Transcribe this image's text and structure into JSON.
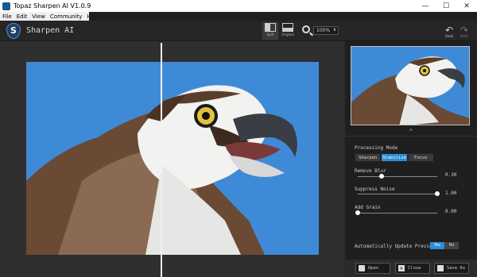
{
  "window": {
    "title": "Topaz Sharpen AI V1.0.9",
    "minimize": "—",
    "maximize": "☐",
    "close": "✕"
  },
  "menu": [
    "File",
    "Edit",
    "View",
    "Community",
    "Help"
  ],
  "app": {
    "name": "Sharpen AI",
    "logo_letter": "S"
  },
  "toolbar": {
    "split_label": "Split",
    "original_label": "Original",
    "zoom_value": "100%",
    "undo_label": "Undo",
    "redo_label": "Redo",
    "undo_icon": "↶",
    "redo_icon": "↷"
  },
  "panel": {
    "collapse_icon": "^",
    "processing_mode_label": "Processing Mode",
    "modes": [
      "Sharpen",
      "Stabilize",
      "Focus"
    ],
    "active_mode": "Stabilize",
    "sliders": [
      {
        "label": "Remove Blur",
        "value_text": "0.30",
        "level": 0.3
      },
      {
        "label": "Suppress Noise",
        "value_text": "1.00",
        "level": 1.0
      },
      {
        "label": "Add Grain",
        "value_text": "0.00",
        "level": 0.0
      }
    ],
    "auto_update_label": "Automatically Update Preview",
    "toggle_yes": "Yes",
    "toggle_no": "No",
    "toggle_state": "Yes"
  },
  "buttons": {
    "open": "Open",
    "close": "Close",
    "save_as": "Save As"
  },
  "colors": {
    "accent": "#2a8ed8",
    "sky": "#3f8ad6",
    "panel_bg": "#1f1f1f",
    "canvas_bg": "#2f2f2f"
  }
}
